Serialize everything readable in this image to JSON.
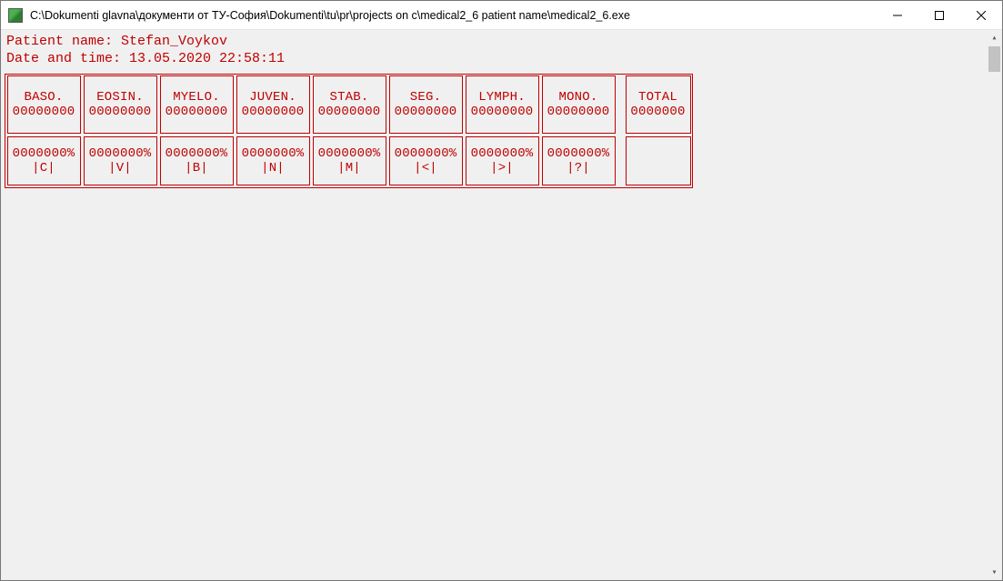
{
  "window": {
    "title": "C:\\Dokumenti glavna\\документи от ТУ-София\\Dokumenti\\tu\\pr\\projects on c\\medical2_6 patient name\\medical2_6.exe"
  },
  "header": {
    "line1": "Patient name: Stefan_Voykov",
    "line2": "Date and time: 13.05.2020 22:58:11"
  },
  "columns": [
    {
      "label": "BASO.",
      "count": "00000000",
      "pct": "0000000%",
      "key": "|C|"
    },
    {
      "label": "EOSIN.",
      "count": "00000000",
      "pct": "0000000%",
      "key": "|V|"
    },
    {
      "label": "MYELO.",
      "count": "00000000",
      "pct": "0000000%",
      "key": "|B|"
    },
    {
      "label": "JUVEN.",
      "count": "00000000",
      "pct": "0000000%",
      "key": "|N|"
    },
    {
      "label": "STAB.",
      "count": "00000000",
      "pct": "0000000%",
      "key": "|M|"
    },
    {
      "label": "SEG.",
      "count": "00000000",
      "pct": "0000000%",
      "key": "|<|"
    },
    {
      "label": "LYMPH.",
      "count": "00000000",
      "pct": "0000000%",
      "key": "|>|"
    },
    {
      "label": "MONO.",
      "count": "00000000",
      "pct": "0000000%",
      "key": "|?|"
    }
  ],
  "total": {
    "label": "TOTAL",
    "count": "0000000"
  }
}
